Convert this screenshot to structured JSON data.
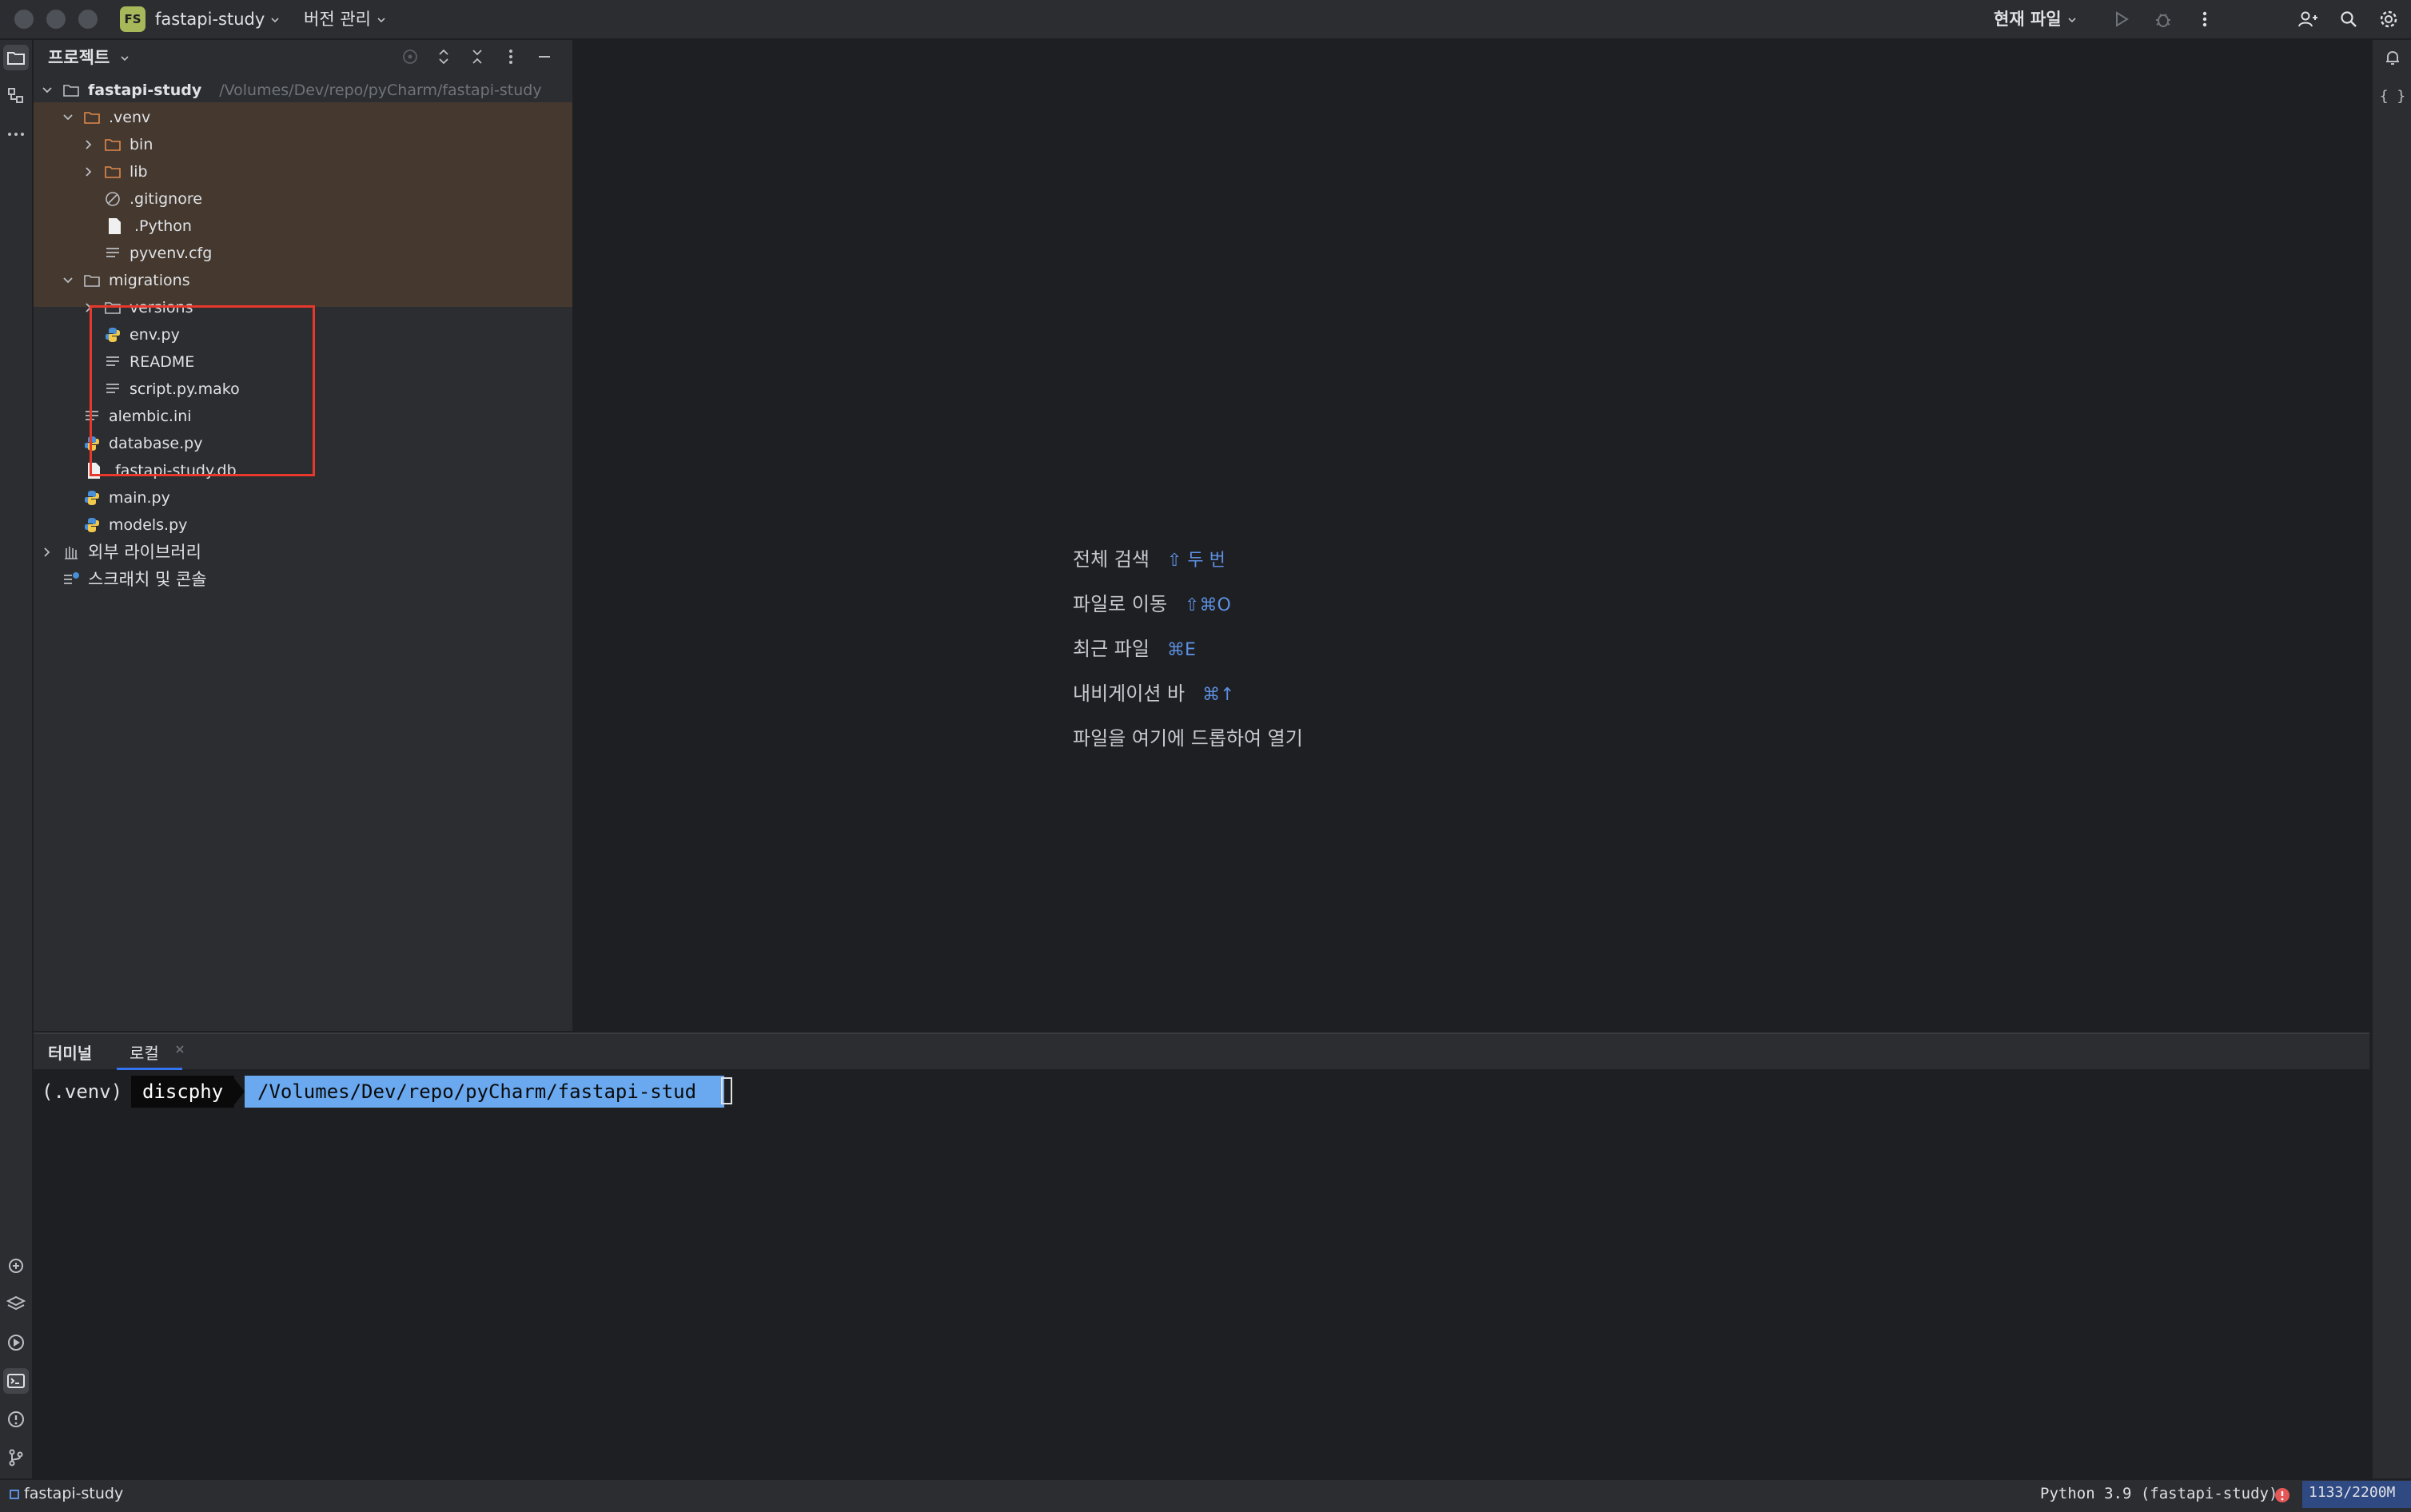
{
  "titlebar": {
    "project_badge": "FS",
    "project_name": "fastapi-study",
    "vcs_menu": "버전 관리",
    "run_config": "현재 파일",
    "icons": [
      "run-icon",
      "debug-icon",
      "more-icon",
      "add-user-icon",
      "search-icon",
      "settings-icon"
    ]
  },
  "project_panel": {
    "title": "프로젝트",
    "tree": [
      {
        "label": "fastapi-study",
        "path": "/Volumes/Dev/repo/pyCharm/fastapi-study",
        "icon": "folder-icon",
        "expanded": true,
        "bold": true
      },
      {
        "label": ".venv",
        "icon": "folder-icon",
        "expanded": true
      },
      {
        "label": "bin",
        "icon": "folder-icon",
        "expanded": false
      },
      {
        "label": "lib",
        "icon": "folder-icon",
        "expanded": false
      },
      {
        "label": ".gitignore",
        "icon": "ignore-file-icon"
      },
      {
        "label": ".Python",
        "icon": "file-icon"
      },
      {
        "label": "pyvenv.cfg",
        "icon": "text-file-icon"
      },
      {
        "label": "migrations",
        "icon": "folder-icon",
        "expanded": true
      },
      {
        "label": "versions",
        "icon": "folder-icon",
        "expanded": false
      },
      {
        "label": "env.py",
        "icon": "python-file-icon"
      },
      {
        "label": "README",
        "icon": "text-file-icon"
      },
      {
        "label": "script.py.mako",
        "icon": "text-file-icon"
      },
      {
        "label": "alembic.ini",
        "icon": "text-file-icon"
      },
      {
        "label": "database.py",
        "icon": "python-file-icon"
      },
      {
        "label": "fastapi-study.db",
        "icon": "file-icon"
      },
      {
        "label": "main.py",
        "icon": "python-file-icon"
      },
      {
        "label": "models.py",
        "icon": "python-file-icon"
      },
      {
        "label": "외부 라이브러리",
        "icon": "library-icon",
        "expanded": false
      },
      {
        "label": "스크래치 및 콘솔",
        "icon": "scratch-icon"
      }
    ]
  },
  "editor_hints": [
    {
      "label": "전체 검색",
      "key": "⇧ 두 번"
    },
    {
      "label": "파일로 이동",
      "key": "⇧⌘O"
    },
    {
      "label": "최근 파일",
      "key": "⌘E"
    },
    {
      "label": "내비게이션 바",
      "key": "⌘↑"
    },
    {
      "label": "파일을 여기에 드롭하여 열기",
      "key": ""
    }
  ],
  "terminal": {
    "tab_title": "터미널",
    "tab_local": "로컬",
    "prompt_venv": "(.venv)",
    "prompt_user": "discphy",
    "prompt_path": "/Volumes/Dev/repo/pyCharm/fastapi-study"
  },
  "statusbar": {
    "project": "fastapi-study",
    "interpreter": "Python 3.9 (fastapi-study)",
    "memory": "1133/2200M"
  },
  "colors": {
    "background": "#1e1f22",
    "panel": "#2b2d30",
    "venv_highlight": "#45392f",
    "annotation_box": "#e8382c",
    "accent": "#3574f0",
    "prompt_path_bg": "#6aa9f0"
  }
}
